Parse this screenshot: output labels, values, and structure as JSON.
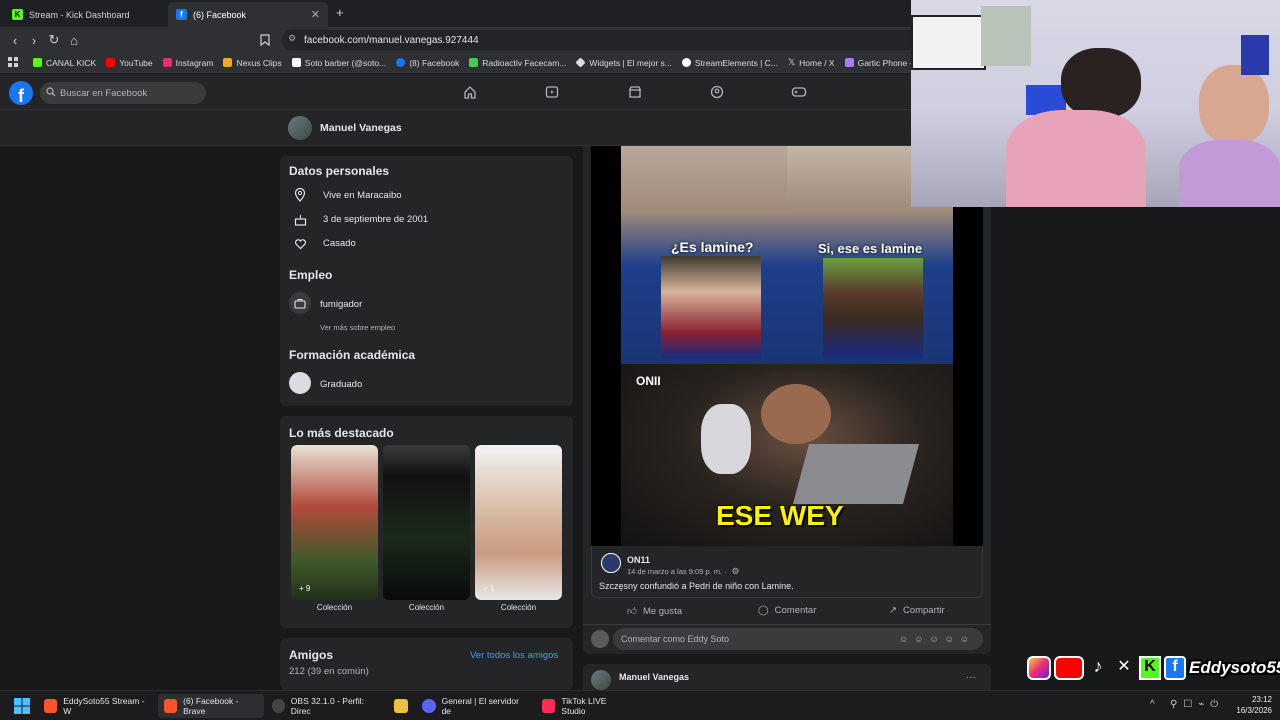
{
  "browser": {
    "tabs": [
      {
        "label": "Stream - Kick Dashboard"
      },
      {
        "label": "(6) Facebook"
      }
    ],
    "new_tab": "+",
    "url": "facebook.com/manuel.vanegas.927444",
    "bookmarks": [
      {
        "label": "CANAL KICK",
        "color": "#53fc18"
      },
      {
        "label": "YouTube",
        "color": "#ff0000"
      },
      {
        "label": "Instagram",
        "color": "#e1306c"
      },
      {
        "label": "Nexus Clips",
        "color": "#f5a623"
      },
      {
        "label": "Soto barber (@soto...",
        "color": "#ffffff"
      },
      {
        "label": "(8) Facebook",
        "color": "#1877f2"
      },
      {
        "label": "Radioactiv Facecam...",
        "color": "#3ecf4a"
      },
      {
        "label": "Widgets | El mejor s...",
        "color": "#dddddd"
      },
      {
        "label": "StreamElements | C...",
        "color": "#ffffff"
      },
      {
        "label": "Home / X",
        "color": "#ffffff"
      },
      {
        "label": "Gartic Phone - Tele",
        "color": "#a77dff"
      }
    ]
  },
  "facebook": {
    "search_placeholder": "Buscar en Facebook",
    "profile_name": "Manuel Vanegas",
    "datos": {
      "title": "Datos personales",
      "items": [
        "Vive en Maracaibo",
        "3 de septiembre de 2001",
        "Casado"
      ]
    },
    "empleo": {
      "title": "Empleo",
      "job": "fumigador",
      "more": "Ver más sobre empleo"
    },
    "formacion": {
      "title": "Formación académica",
      "item": "Graduado"
    },
    "destacado": {
      "title": "Lo más destacado",
      "items": [
        {
          "label": "Colección",
          "count": "+ 9"
        },
        {
          "label": "Colección",
          "count": ""
        },
        {
          "label": "Colección",
          "count": "+ 1"
        }
      ]
    },
    "amigos": {
      "title": "Amigos",
      "count": "212 (39 en común)",
      "link": "Ver todos los amigos"
    },
    "post": {
      "meme_text_1": "¿Es lamine?",
      "meme_text_2": "Si, ese es lamine",
      "meme_caption": "ESE WEY",
      "meme_logo": "ONII",
      "author": "ON11",
      "date": "14 de marzo a las 9:09 p. m. ·",
      "text": "Szczęsny confundió a Pedri de niño con Lamine.",
      "like": "Me gusta",
      "comment": "Comentar",
      "share": "Compartir",
      "comment_placeholder": "Comentar como Eddy Soto"
    },
    "next_post": {
      "author": "Manuel Vanegas",
      "menu": "···"
    }
  },
  "overlay": {
    "handle": "Eddysoto55"
  },
  "taskbar": {
    "items": [
      {
        "label": "EddySoto55 Stream - W",
        "color": "#fb542b"
      },
      {
        "label": "(6) Facebook - Brave",
        "color": "#fb542b"
      },
      {
        "label": "OBS 32.1.0 - Perfil: Direc",
        "color": "#444444"
      },
      {
        "label": "",
        "color": "#f0c040"
      },
      {
        "label": "General | El servidor de",
        "color": "#5865f2"
      },
      {
        "label": "TikTok LIVE Studio",
        "color": "#fe2c55"
      }
    ],
    "time": "23:12",
    "date": "16/3/2026",
    "overflow": "^"
  }
}
